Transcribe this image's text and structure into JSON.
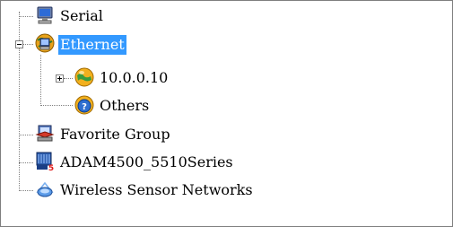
{
  "tree": {
    "serial": {
      "label": "Serial",
      "icon": "computer-monitor-icon"
    },
    "ethernet": {
      "label": "Ethernet",
      "icon": "network-globe-computer-icon",
      "selected": true,
      "expanded": true
    },
    "ip_host": {
      "label": "10.0.0.10",
      "icon": "globe-icon",
      "expanded": false
    },
    "others": {
      "label": "Others",
      "icon": "question-globe-icon"
    },
    "favorite_group": {
      "label": "Favorite Group",
      "icon": "favorite-group-icon"
    },
    "adam": {
      "label": "ADAM4500_5510Series",
      "icon": "adam-device-icon"
    },
    "wsn": {
      "label": "Wireless Sensor Networks",
      "icon": "wireless-sensor-icon"
    }
  },
  "colors": {
    "selection": "#3399ff",
    "tree_lines": "#808080"
  }
}
